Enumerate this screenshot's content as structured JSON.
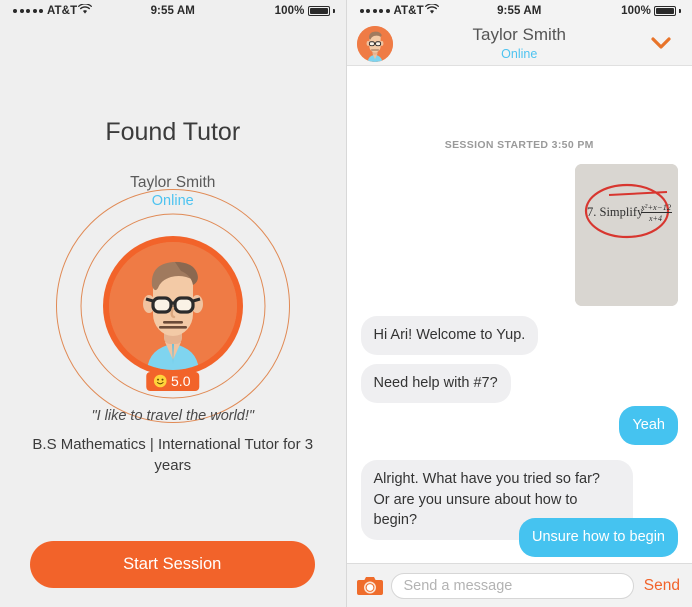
{
  "status_bar": {
    "carrier": "AT&T",
    "time": "9:55 AM",
    "battery": "100%",
    "signal_dots": 5,
    "wifi_icon": "wifi-icon",
    "battery_icon": "battery-full-icon"
  },
  "colors": {
    "accent_orange": "#f2632a",
    "ring_orange": "#e08a55",
    "online_blue": "#4ec3f0",
    "bubble_blue": "#45c3f0",
    "bubble_gray": "#efeff1",
    "panel_bg": "#efefef"
  },
  "left_screen": {
    "title": "Found Tutor",
    "tutor_name": "Taylor Smith",
    "tutor_status": "Online",
    "rating": "5.0",
    "rating_icon": "smiley-face-icon",
    "quote": "\"I like to travel the world!\"",
    "credentials": "B.S Mathematics | International Tutor for 3 years",
    "start_button": "Start Session",
    "avatar_icon": "tutor-avatar-illustration"
  },
  "right_screen": {
    "header": {
      "name": "Taylor Smith",
      "status": "Online",
      "avatar_icon": "tutor-avatar-illustration",
      "collapse_icon": "chevron-down-icon"
    },
    "session_label": "SESSION STARTED 3:50 PM",
    "photo_message": {
      "alt": "homework-photo",
      "problem_number": "7.",
      "problem_text": "Simplify",
      "numerator": "x²+x−12",
      "denominator": "x+4",
      "annotation": "red-circle-annotation"
    },
    "messages": [
      {
        "sender": "them",
        "text": "Hi Ari! Welcome to Yup."
      },
      {
        "sender": "them",
        "text": "Need help with #7?"
      },
      {
        "sender": "me",
        "text": "Yeah"
      },
      {
        "sender": "them",
        "text": "Alright. What have you tried so far? Or are you unsure about how to begin?"
      },
      {
        "sender": "me",
        "text": "Unsure how to begin"
      }
    ],
    "input_bar": {
      "camera_icon": "camera-icon",
      "placeholder": "Send a message",
      "value": "",
      "send_label": "Send"
    }
  }
}
